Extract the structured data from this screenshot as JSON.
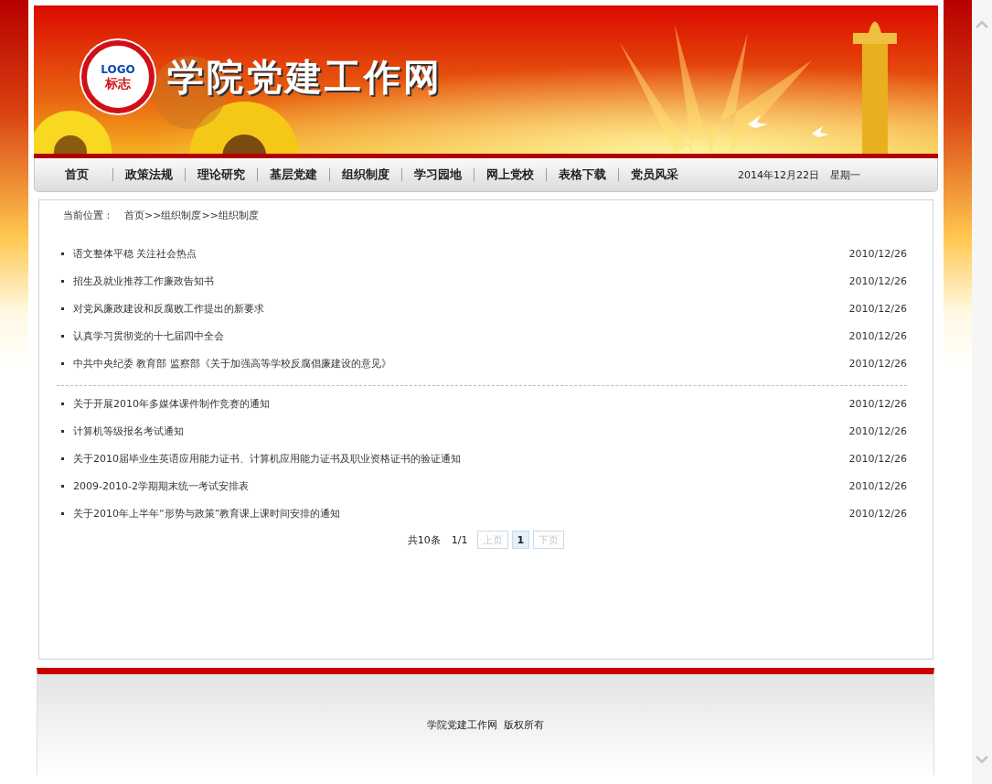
{
  "header": {
    "site_title": "学院党建工作网",
    "logo": {
      "top": "LOGO",
      "bottom": "标志"
    }
  },
  "nav": {
    "items": [
      {
        "label": "首页"
      },
      {
        "label": "政策法规"
      },
      {
        "label": "理论研究"
      },
      {
        "label": "基层党建"
      },
      {
        "label": "组织制度"
      },
      {
        "label": "学习园地"
      },
      {
        "label": "网上党校"
      },
      {
        "label": "表格下载"
      },
      {
        "label": "党员风采"
      }
    ],
    "date": "2014年12月22日",
    "weekday": "星期一"
  },
  "breadcrumb": {
    "label": "当前位置：",
    "path": "首页>>组织制度>>组织制度"
  },
  "news_lists": [
    {
      "items": [
        {
          "title": "语文整体平稳 关注社会热点",
          "date": "2010/12/26"
        },
        {
          "title": "招生及就业推荐工作廉政告知书",
          "date": "2010/12/26"
        },
        {
          "title": "对党风廉政建设和反腐败工作提出的新要求",
          "date": "2010/12/26"
        },
        {
          "title": "认真学习贯彻党的十七届四中全会",
          "date": "2010/12/26"
        },
        {
          "title": "中共中央纪委 教育部 监察部《关于加强高等学校反腐倡廉建设的意见》",
          "date": "2010/12/26"
        }
      ]
    },
    {
      "items": [
        {
          "title": "关于开展2010年多媒体课件制作竞赛的通知",
          "date": "2010/12/26"
        },
        {
          "title": "计算机等级报名考试通知",
          "date": "2010/12/26"
        },
        {
          "title": "关于2010届毕业生英语应用能力证书、计算机应用能力证书及职业资格证书的验证通知",
          "date": "2010/12/26"
        },
        {
          "title": "2009-2010-2学期期末统一考试安排表",
          "date": "2010/12/26"
        },
        {
          "title": "关于2010年上半年“形势与政策”教育课上课时间安排的通知",
          "date": "2010/12/26"
        }
      ]
    }
  ],
  "pagination": {
    "total": "共10条",
    "page": "1/1",
    "buttons": [
      {
        "label": "上页",
        "disabled": true,
        "selected": false
      },
      {
        "label": "1",
        "disabled": false,
        "selected": true
      },
      {
        "label": "下页",
        "disabled": true,
        "selected": false
      }
    ]
  },
  "footer": {
    "copyright": "学院党建工作网  版权所有"
  }
}
